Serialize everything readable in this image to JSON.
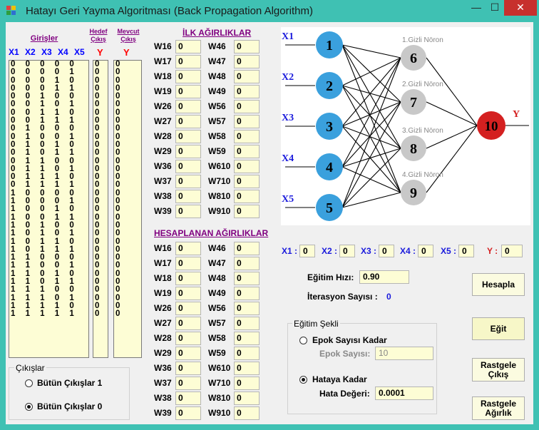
{
  "window": {
    "title": "Hatayı Geri Yayma Algoritması (Back Propagation Algorithm)",
    "minimize": "—",
    "maximize": "☐",
    "close": "✕",
    "close_color": "#c7302d"
  },
  "inputs": {
    "header": "Girişler",
    "hedef": "Hedef Çıkış",
    "mevcut": "Mevcut Çıkış",
    "cols": [
      "X1",
      "X2",
      "X3",
      "X4",
      "X5"
    ],
    "ylabel": "Y",
    "ylabel2": "Y",
    "rows": [
      "0 0 0 0 0",
      "0 0 0 0 1",
      "0 0 0 1 0",
      "0 0 0 1 1",
      "0 0 1 0 0",
      "0 0 1 0 1",
      "0 0 1 1 0",
      "0 0 1 1 1",
      "0 1 0 0 0",
      "0 1 0 0 1",
      "0 1 0 1 0",
      "0 1 0 1 1",
      "0 1 1 0 0",
      "0 1 1 0 1",
      "0 1 1 1 0",
      "0 1 1 1 1",
      "1 0 0 0 0",
      "1 0 0 0 1",
      "1 0 0 1 0",
      "1 0 0 1 1",
      "1 0 1 0 0",
      "1 0 1 0 1",
      "1 0 1 1 0",
      "1 0 1 1 1",
      "1 1 0 0 0",
      "1 1 0 0 1",
      "1 1 0 1 0",
      "1 1 0 1 1",
      "1 1 1 0 0",
      "1 1 1 0 1",
      "1 1 1 1 0",
      "1 1 1 1 1"
    ],
    "hedef_values": [
      "0",
      "0",
      "0",
      "0",
      "0",
      "0",
      "0",
      "0",
      "0",
      "0",
      "0",
      "0",
      "0",
      "0",
      "0",
      "0",
      "0",
      "0",
      "0",
      "0",
      "0",
      "0",
      "0",
      "0",
      "0",
      "0",
      "0",
      "0",
      "0",
      "0",
      "0",
      "0"
    ],
    "mevcut_values": [
      "0",
      "0",
      "0",
      "0",
      "0",
      "0",
      "0",
      "0",
      "0",
      "0",
      "0",
      "0",
      "0",
      "0",
      "0",
      "0",
      "0",
      "0",
      "0",
      "0",
      "0",
      "0",
      "0",
      "0",
      "0",
      "0",
      "0",
      "0",
      "0",
      "0",
      "0",
      "0"
    ]
  },
  "outputs_group": {
    "label": "Çıkışlar",
    "option1": "Bütün Çıkışlar 1",
    "option2": "Bütün Çıkışlar 0",
    "selected": "option2"
  },
  "initial_weights": {
    "title": "İLK AĞIRLIKLAR",
    "left": [
      [
        "W16",
        "0"
      ],
      [
        "W17",
        "0"
      ],
      [
        "W18",
        "0"
      ],
      [
        "W19",
        "0"
      ],
      [
        "W26",
        "0"
      ],
      [
        "W27",
        "0"
      ],
      [
        "W28",
        "0"
      ],
      [
        "W29",
        "0"
      ],
      [
        "W36",
        "0"
      ],
      [
        "W37",
        "0"
      ],
      [
        "W38",
        "0"
      ],
      [
        "W39",
        "0"
      ]
    ],
    "right": [
      [
        "W46",
        "0"
      ],
      [
        "W47",
        "0"
      ],
      [
        "W48",
        "0"
      ],
      [
        "W49",
        "0"
      ],
      [
        "W56",
        "0"
      ],
      [
        "W57",
        "0"
      ],
      [
        "W58",
        "0"
      ],
      [
        "W59",
        "0"
      ],
      [
        "W610",
        "0"
      ],
      [
        "W710",
        "0"
      ],
      [
        "W810",
        "0"
      ],
      [
        "W910",
        "0"
      ]
    ]
  },
  "computed_weights": {
    "title": "HESAPLANAN AĞIRLIKLAR",
    "left": [
      [
        "W16",
        "0"
      ],
      [
        "W17",
        "0"
      ],
      [
        "W18",
        "0"
      ],
      [
        "W19",
        "0"
      ],
      [
        "W26",
        "0"
      ],
      [
        "W27",
        "0"
      ],
      [
        "W28",
        "0"
      ],
      [
        "W29",
        "0"
      ],
      [
        "W36",
        "0"
      ],
      [
        "W37",
        "0"
      ],
      [
        "W38",
        "0"
      ],
      [
        "W39",
        "0"
      ]
    ],
    "right": [
      [
        "W46",
        "0"
      ],
      [
        "W47",
        "0"
      ],
      [
        "W48",
        "0"
      ],
      [
        "W49",
        "0"
      ],
      [
        "W56",
        "0"
      ],
      [
        "W57",
        "0"
      ],
      [
        "W58",
        "0"
      ],
      [
        "W59",
        "0"
      ],
      [
        "W610",
        "0"
      ],
      [
        "W710",
        "0"
      ],
      [
        "W810",
        "0"
      ],
      [
        "W910",
        "0"
      ]
    ]
  },
  "diagram": {
    "inputs": [
      "X1",
      "X2",
      "X3",
      "X4",
      "X5"
    ],
    "input_nodes": [
      "1",
      "2",
      "3",
      "4",
      "5"
    ],
    "hidden_nodes": [
      "6",
      "7",
      "8",
      "9"
    ],
    "hidden_labels": [
      "1.Gizli Nöron",
      "2.Gizli Nöron",
      "3.Gizli Nöron",
      "4.Gizli Nöron"
    ],
    "output_node": "10",
    "output_label": "Y",
    "colors": {
      "input": "#3aa0dd",
      "hidden": "#c8c8c8",
      "output": "#d42020",
      "xlabel": "#1a1adc",
      "ylabel": "#d42020"
    }
  },
  "io_values": [
    {
      "label": "X1 :",
      "value": "0"
    },
    {
      "label": "X2 :",
      "value": "0"
    },
    {
      "label": "X3 :",
      "value": "0"
    },
    {
      "label": "X4 :",
      "value": "0"
    },
    {
      "label": "X5 :",
      "value": "0"
    },
    {
      "label": "Y :",
      "value": "0"
    }
  ],
  "training": {
    "rate_label": "Eğitim Hızı:",
    "rate_value": "0.90",
    "iter_label": "İterasyon Sayısı :",
    "iter_value": "0"
  },
  "mode_group": {
    "label": "Eğitim Şekli",
    "epoch_option": "Epok Sayısı Kadar",
    "epoch_label": "Epok Sayısı:",
    "epoch_value": "10",
    "error_option": "Hataya Kadar",
    "error_label": "Hata Değeri:",
    "error_value": "0.0001",
    "selected": "error"
  },
  "buttons": {
    "calculate": "Hesapla",
    "train": "Eğit",
    "random_output": "Rastgele Çıkış",
    "random_weights": "Rastgele Ağırlık"
  }
}
